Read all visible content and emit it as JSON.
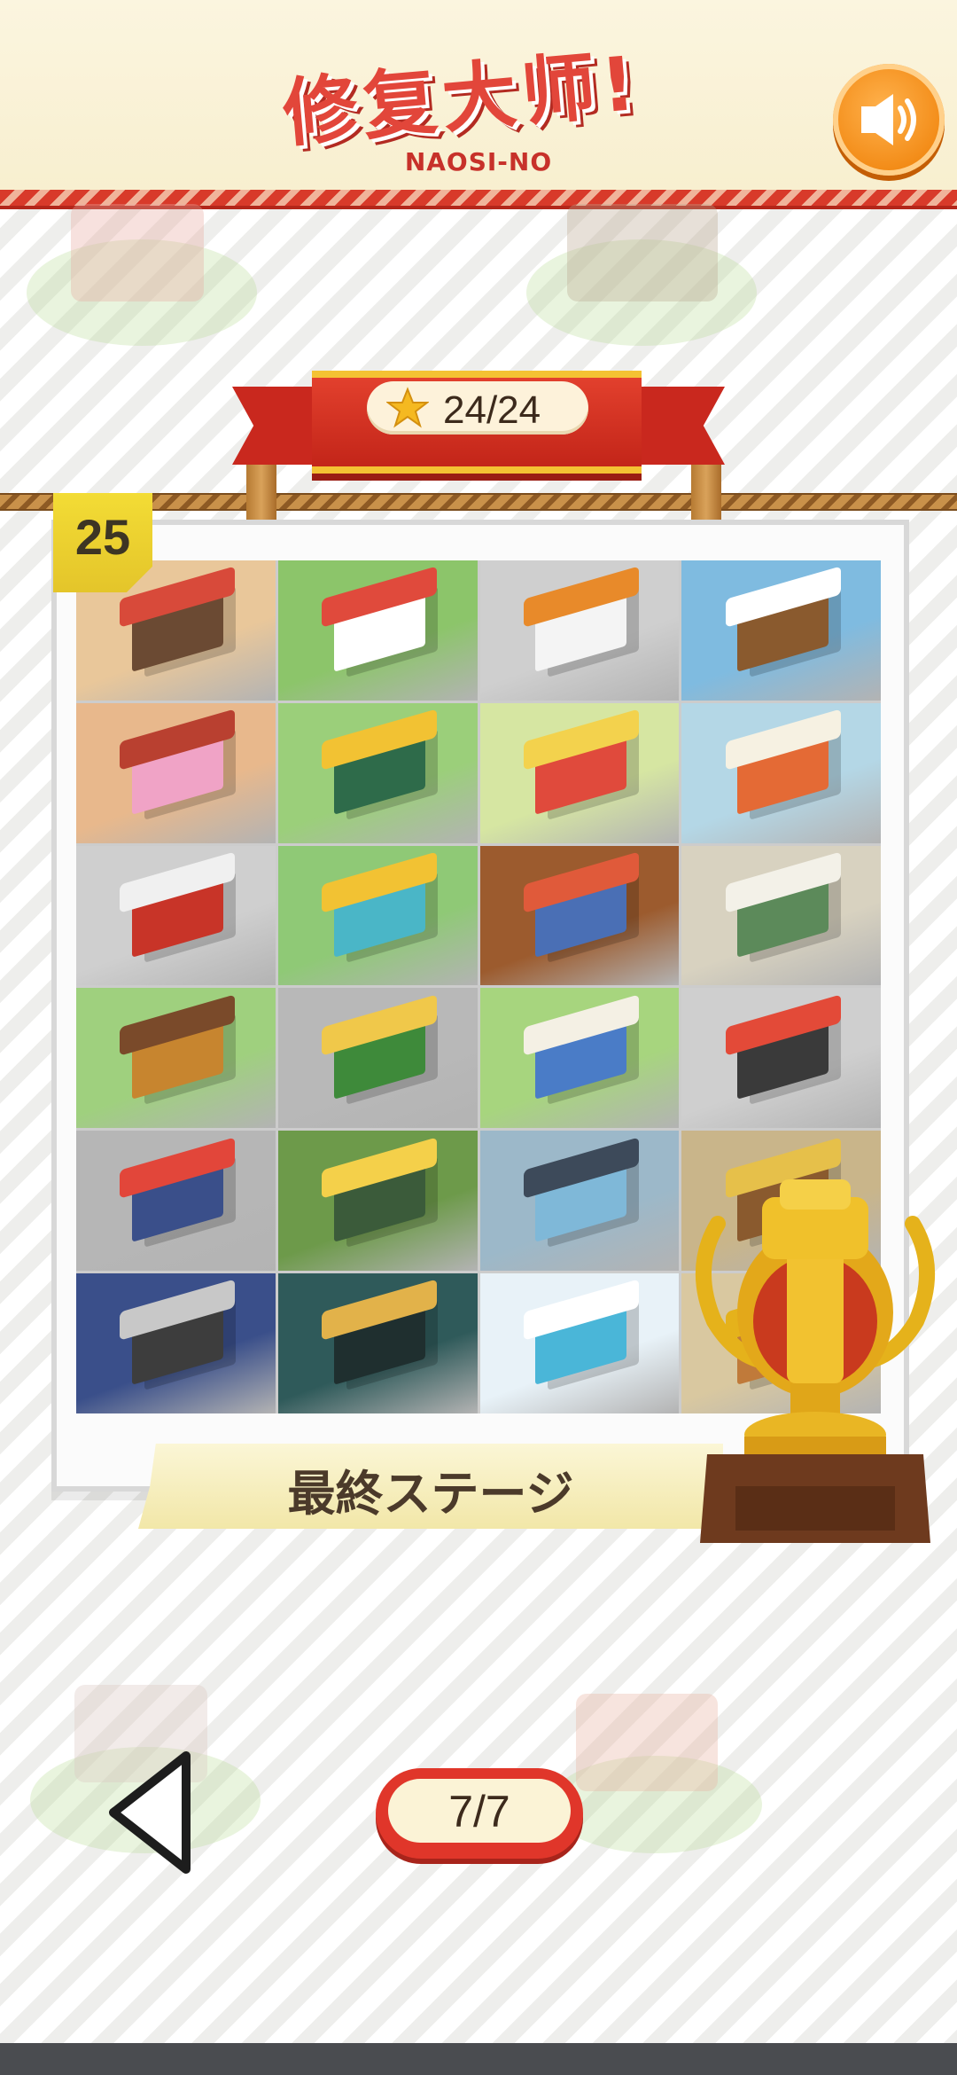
{
  "header": {
    "title": "修复大师!",
    "subtitle": "NAOSI-NO",
    "sound_icon": "speaker-icon"
  },
  "progress": {
    "star_icon": "star-icon",
    "score": "24/24"
  },
  "level": {
    "number": "25",
    "stage_label": "最終ステージ"
  },
  "stage_tiles": [
    "coffee-shop",
    "burger-shop",
    "gas-station",
    "snow-cabin",
    "claw-machine",
    "flower-shop",
    "circus",
    "cash-register-shop",
    "post-office",
    "power-station",
    "market-stalls",
    "general-store",
    "bear-house",
    "teapot-cafe",
    "egg-farm",
    "pizza-diner",
    "police-station",
    "duck-garden",
    "bank",
    "trophy-hidden",
    "cinema",
    "record-shop",
    "fountain-plaza",
    "trophy-hidden"
  ],
  "navigation": {
    "prev_icon": "triangle-left-icon",
    "page": "7/7"
  },
  "colors": {
    "accent_red": "#e0362a",
    "gold": "#f4c233",
    "cream": "#fbf3d6"
  }
}
